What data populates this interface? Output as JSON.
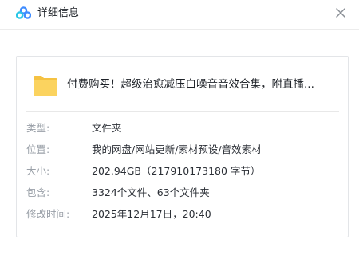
{
  "dialog": {
    "title": "详细信息",
    "logo_icon": "cloud-drive-logo",
    "close_icon": "close-icon"
  },
  "file": {
    "icon": "folder-icon",
    "name": "付费购买！超级治愈减压白噪音音效合集，附直播..."
  },
  "details": {
    "type_label": "类型:",
    "type_value": "文件夹",
    "location_label": "位置:",
    "location_value": "我的网盘/网站更新/素材预设/音效素材",
    "size_label": "大小:",
    "size_value": "202.94GB（217910173180 字节）",
    "contains_label": "包含:",
    "contains_value": "3324个文件、63个文件夹",
    "modified_label": "修改时间:",
    "modified_value": "2025年12月17日，20:40"
  },
  "colors": {
    "folder": "#fbd35f",
    "logo_blue": "#3f8cff",
    "logo_cyan": "#29c6e6",
    "label": "#9aa0a8"
  }
}
